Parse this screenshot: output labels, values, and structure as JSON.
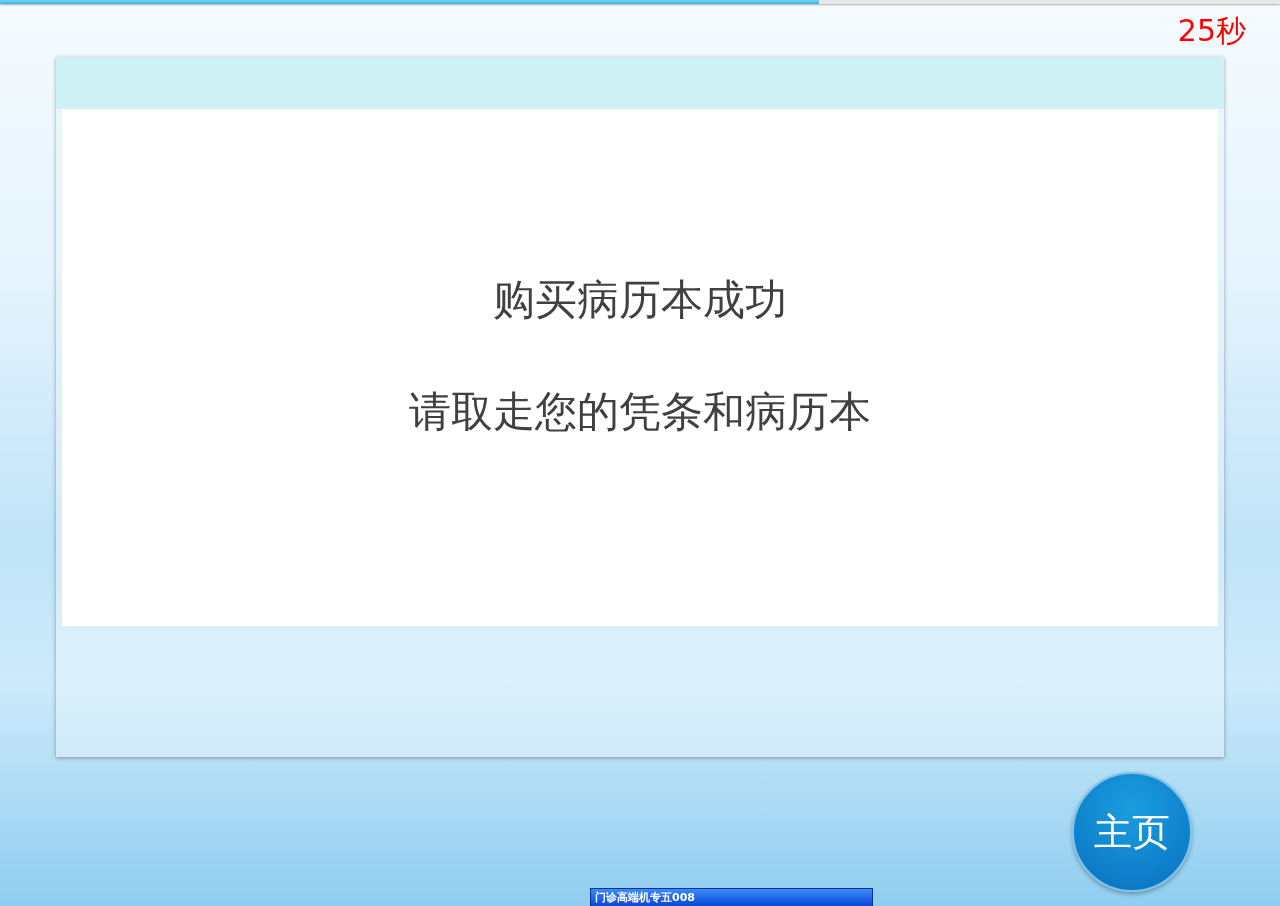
{
  "progress": {
    "level": 0.64
  },
  "countdown": "25秒",
  "message": {
    "lines": [
      "购买病历本成功",
      "请取走您的凭条和病历本"
    ]
  },
  "home_button": {
    "label": "主页"
  },
  "taskbar_window": {
    "title": "门诊高端机专五008"
  }
}
